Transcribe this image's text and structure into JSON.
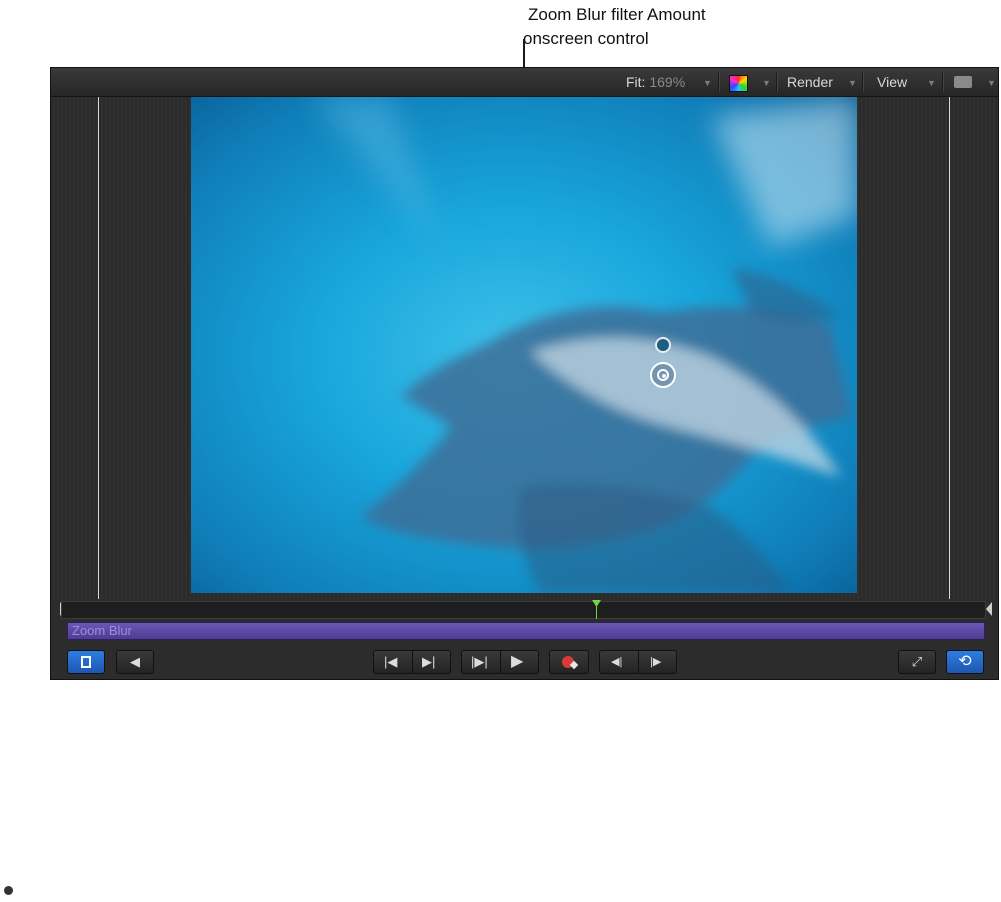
{
  "callout": {
    "line1": "Zoom Blur filter Amount",
    "line2": "onscreen control"
  },
  "toolbar": {
    "fit_label": "Fit:",
    "fit_value": "169%",
    "render_label": "Render",
    "view_label": "View",
    "color_icon": "color-channels-icon",
    "layout_icon": "layout-icon"
  },
  "timeline": {
    "filter_name": "Zoom Blur"
  },
  "transport": {
    "inspector_toggle_icon": "inspector-toggle-icon",
    "mute_icon": "speaker-icon",
    "go_to_start_icon": "|◀",
    "go_to_end_icon": "▶|",
    "play_range_icon": "|▶|",
    "play_icon": "▶",
    "record_icon": "record-keyframe-icon",
    "prev_keyframe_icon": "◀|",
    "next_keyframe_icon": "|▶",
    "fullscreen_icon": "fullscreen-icon",
    "loop_icon": "loop-icon"
  },
  "colors": {
    "viewer_bg": "#2c2c2c",
    "filter_bar": "#5a47a3",
    "playhead": "#6fd64a",
    "accent_blue": "#2e7de0",
    "record_red": "#d83a3a"
  }
}
